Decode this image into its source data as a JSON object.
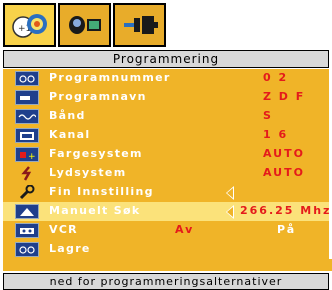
{
  "tabs": [
    {
      "name": "picture-settings-icon"
    },
    {
      "name": "sound-settings-icon"
    },
    {
      "name": "connection-settings-icon"
    }
  ],
  "title": "Programmering",
  "rows": [
    {
      "label": "Programnummer",
      "value": "0 2",
      "icon": "program-number-icon"
    },
    {
      "label": "Programnavn",
      "value": "Z D F",
      "icon": "program-name-icon"
    },
    {
      "label": "Bånd",
      "value": "S",
      "icon": "band-icon"
    },
    {
      "label": "Kanal",
      "value": "1 6",
      "icon": "channel-icon"
    },
    {
      "label": "Fargesystem",
      "value": "AUTO",
      "icon": "color-system-icon"
    },
    {
      "label": "Lydsystem",
      "value": "AUTO",
      "icon": "sound-system-icon"
    },
    {
      "label": "Fin Innstilling",
      "icon": "fine-tuning-icon"
    },
    {
      "label": "Manuelt Søk",
      "value": "266.25 Mhz",
      "icon": "manual-search-icon"
    },
    {
      "label": "VCR",
      "option_off": "Av",
      "option_on": "På",
      "icon": "vcr-icon"
    },
    {
      "label": "Lagre",
      "icon": "save-icon"
    }
  ],
  "footer": "ned for programmeringsalternativer"
}
